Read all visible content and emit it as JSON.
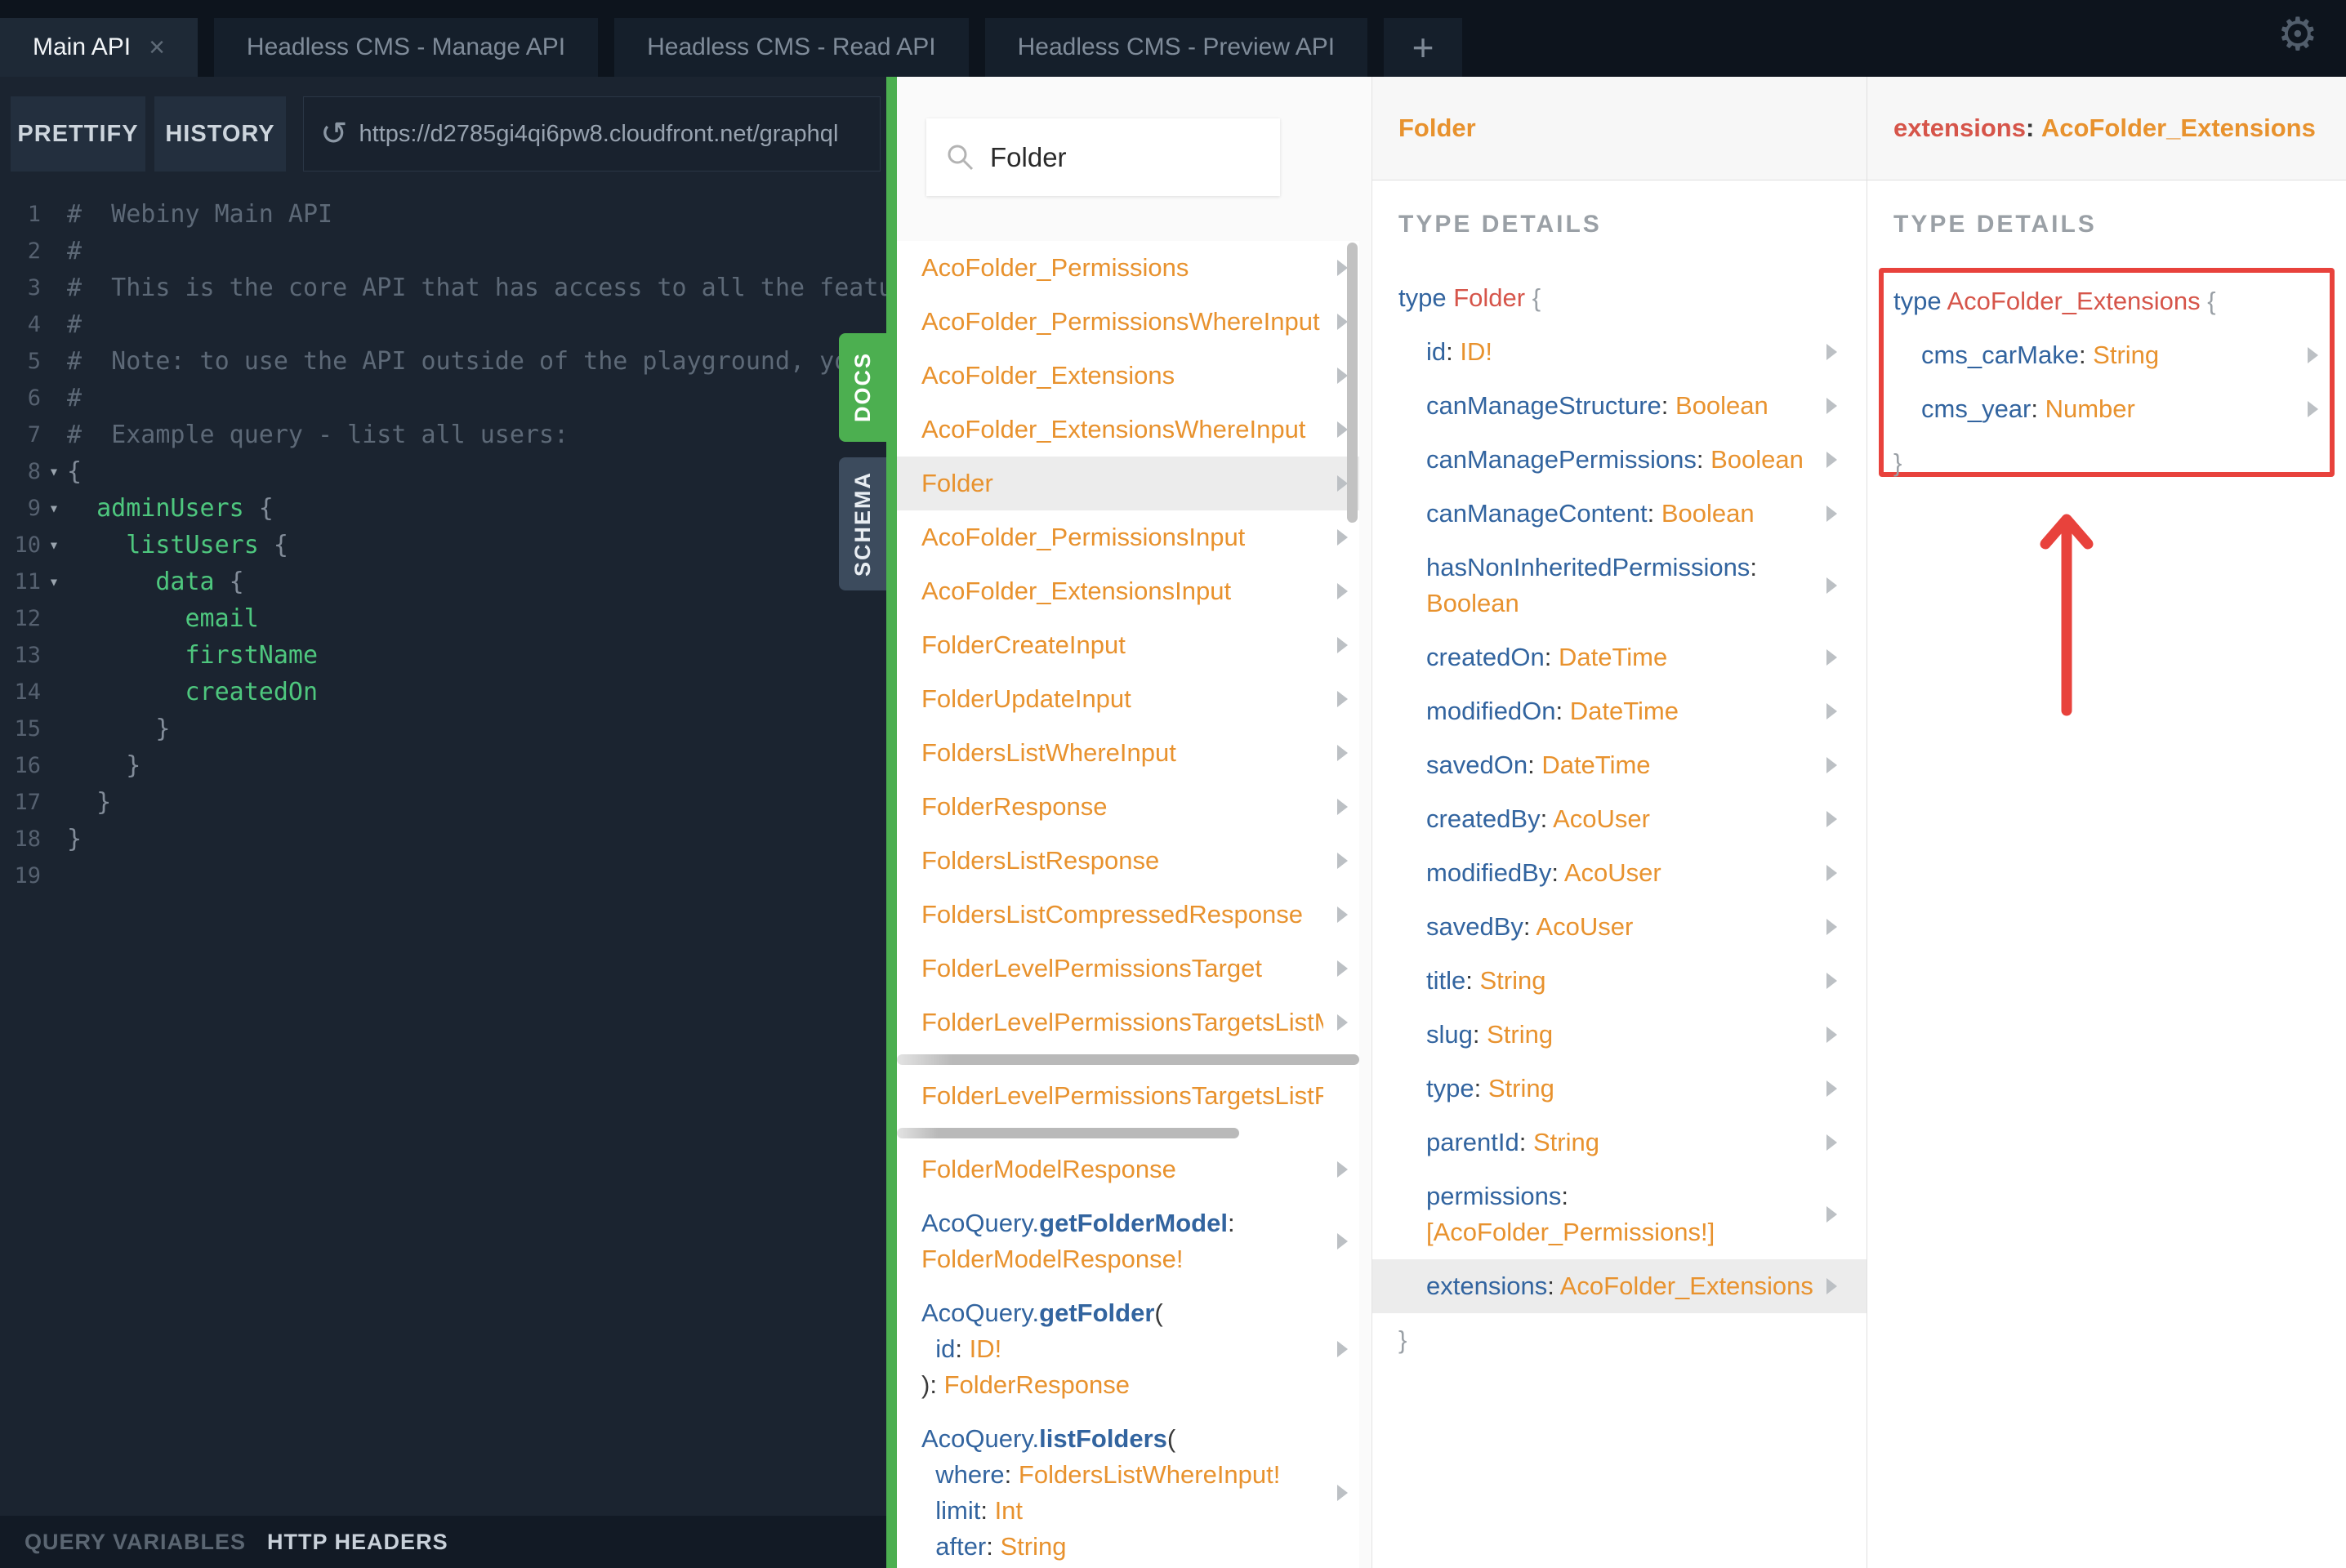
{
  "colors": {
    "accent_green": "#4caf50",
    "type_orange": "#e8922e",
    "field_blue": "#32649f",
    "typename_red": "#d6554a",
    "annotation_red": "#e8423c",
    "editor_green": "#4ec77e"
  },
  "tabs": {
    "items": [
      {
        "label": "Main API",
        "active": true,
        "close": "×"
      },
      {
        "label": "Headless CMS - Manage API",
        "active": false
      },
      {
        "label": "Headless CMS - Read API",
        "active": false
      },
      {
        "label": "Headless CMS - Preview API",
        "active": false
      }
    ],
    "add_label": "+"
  },
  "toolbar": {
    "prettify_label": "PRETTIFY",
    "history_label": "HISTORY",
    "refresh_icon": "↺",
    "url": "https://d2785gi4qi6pw8.cloudfront.net/graphql"
  },
  "gear_icon": "⚙",
  "side_tabs": {
    "docs": "DOCS",
    "schema": "SCHEMA"
  },
  "footer": {
    "query_variables": "QUERY VARIABLES",
    "http_headers": "HTTP HEADERS"
  },
  "editor": {
    "lines": [
      {
        "n": "1",
        "fold": false,
        "segs": [
          {
            "t": "#  Webiny Main API",
            "c": "cm"
          }
        ]
      },
      {
        "n": "2",
        "fold": false,
        "segs": [
          {
            "t": "#",
            "c": "cm"
          }
        ]
      },
      {
        "n": "3",
        "fold": false,
        "segs": [
          {
            "t": "#  This is the core API that has access to all the featu",
            "c": "cm"
          }
        ]
      },
      {
        "n": "4",
        "fold": false,
        "segs": [
          {
            "t": "#",
            "c": "cm"
          }
        ]
      },
      {
        "n": "5",
        "fold": false,
        "segs": [
          {
            "t": "#  Note: to use the API outside of the playground, yo",
            "c": "cm"
          }
        ]
      },
      {
        "n": "6",
        "fold": false,
        "segs": [
          {
            "t": "#",
            "c": "cm"
          }
        ]
      },
      {
        "n": "7",
        "fold": false,
        "segs": [
          {
            "t": "#  Example query - list all users:",
            "c": "cm"
          }
        ]
      },
      {
        "n": "8",
        "fold": true,
        "segs": [
          {
            "t": "{",
            "c": "brc"
          }
        ]
      },
      {
        "n": "9",
        "fold": true,
        "segs": [
          {
            "t": "  adminUsers",
            "c": "gr"
          },
          {
            "t": " {",
            "c": "brc"
          }
        ]
      },
      {
        "n": "10",
        "fold": true,
        "segs": [
          {
            "t": "    listUsers",
            "c": "gr"
          },
          {
            "t": " {",
            "c": "brc"
          }
        ]
      },
      {
        "n": "11",
        "fold": true,
        "segs": [
          {
            "t": "      data",
            "c": "gr"
          },
          {
            "t": " {",
            "c": "brc"
          }
        ]
      },
      {
        "n": "12",
        "fold": false,
        "segs": [
          {
            "t": "        email",
            "c": "gr"
          }
        ]
      },
      {
        "n": "13",
        "fold": false,
        "segs": [
          {
            "t": "        firstName",
            "c": "gr"
          }
        ]
      },
      {
        "n": "14",
        "fold": false,
        "segs": [
          {
            "t": "        createdOn",
            "c": "gr"
          }
        ]
      },
      {
        "n": "15",
        "fold": false,
        "segs": [
          {
            "t": "      }",
            "c": "brc"
          }
        ]
      },
      {
        "n": "16",
        "fold": false,
        "segs": [
          {
            "t": "    }",
            "c": "brc"
          }
        ]
      },
      {
        "n": "17",
        "fold": false,
        "segs": [
          {
            "t": "  }",
            "c": "brc"
          }
        ]
      },
      {
        "n": "18",
        "fold": false,
        "segs": [
          {
            "t": "}",
            "c": "brc"
          }
        ]
      },
      {
        "n": "19",
        "fold": false,
        "segs": [
          {
            "t": "",
            "c": "cm"
          }
        ]
      }
    ]
  },
  "explorer": {
    "search_value": "Folder",
    "rows": [
      {
        "click": true,
        "ch": true,
        "lines": [
          [
            {
              "t": "AcoFolder_Permissions",
              "c": "or"
            }
          ]
        ]
      },
      {
        "click": true,
        "ch": true,
        "lines": [
          [
            {
              "t": "AcoFolder_PermissionsWhereInput",
              "c": "or"
            }
          ]
        ]
      },
      {
        "click": true,
        "ch": true,
        "lines": [
          [
            {
              "t": "AcoFolder_Extensions",
              "c": "or"
            }
          ]
        ]
      },
      {
        "click": true,
        "ch": true,
        "lines": [
          [
            {
              "t": "AcoFolder_ExtensionsWhereInput",
              "c": "or"
            }
          ]
        ]
      },
      {
        "click": true,
        "ch": true,
        "h": true,
        "lines": [
          [
            {
              "t": "Folder",
              "c": "or"
            }
          ]
        ]
      },
      {
        "click": true,
        "ch": true,
        "lines": [
          [
            {
              "t": "AcoFolder_PermissionsInput",
              "c": "or"
            }
          ]
        ]
      },
      {
        "click": true,
        "ch": true,
        "lines": [
          [
            {
              "t": "AcoFolder_ExtensionsInput",
              "c": "or"
            }
          ]
        ]
      },
      {
        "click": true,
        "ch": true,
        "lines": [
          [
            {
              "t": "FolderCreateInput",
              "c": "or"
            }
          ]
        ]
      },
      {
        "click": true,
        "ch": true,
        "lines": [
          [
            {
              "t": "FolderUpdateInput",
              "c": "or"
            }
          ]
        ]
      },
      {
        "click": true,
        "ch": true,
        "lines": [
          [
            {
              "t": "FoldersListWhereInput",
              "c": "or"
            }
          ]
        ]
      },
      {
        "click": true,
        "ch": true,
        "lines": [
          [
            {
              "t": "FolderResponse",
              "c": "or"
            }
          ]
        ]
      },
      {
        "click": true,
        "ch": true,
        "lines": [
          [
            {
              "t": "FoldersListResponse",
              "c": "or"
            }
          ]
        ]
      },
      {
        "click": true,
        "ch": true,
        "lines": [
          [
            {
              "t": "FoldersListCompressedResponse",
              "c": "or"
            }
          ]
        ]
      },
      {
        "click": true,
        "ch": true,
        "lines": [
          [
            {
              "t": "FolderLevelPermissionsTarget",
              "c": "or"
            }
          ]
        ]
      },
      {
        "click": true,
        "ch": true,
        "lines": [
          [
            {
              "t": "FolderLevelPermissionsTargetsListMeta",
              "c": "or"
            }
          ]
        ]
      },
      {
        "type": "hbar",
        "w": "100%"
      },
      {
        "click": true,
        "ch": false,
        "lines": [
          [
            {
              "t": "FolderLevelPermissionsTargetsListRespo",
              "c": "or"
            }
          ]
        ]
      },
      {
        "type": "hbar",
        "w": "74%"
      },
      {
        "click": true,
        "ch": true,
        "lines": [
          [
            {
              "t": "FolderModelResponse",
              "c": "or"
            }
          ]
        ]
      },
      {
        "click": true,
        "ch": true,
        "lines": [
          [
            {
              "t": "AcoQuery.",
              "c": "bl"
            },
            {
              "t": "getFolderModel",
              "c": "bb"
            },
            {
              "t": ":",
              "c": "dk"
            }
          ],
          [
            {
              "t": "FolderModelResponse!",
              "c": "or"
            }
          ]
        ]
      },
      {
        "click": true,
        "ch": true,
        "lines": [
          [
            {
              "t": "AcoQuery.",
              "c": "bl"
            },
            {
              "t": "getFolder",
              "c": "bb"
            },
            {
              "t": "(",
              "c": "dk"
            }
          ],
          [
            {
              "t": "  id",
              "c": "bl"
            },
            {
              "t": ": ",
              "c": "dk"
            },
            {
              "t": "ID!",
              "c": "or"
            }
          ],
          [
            {
              "t": "): ",
              "c": "dk"
            },
            {
              "t": "FolderResponse",
              "c": "or"
            }
          ]
        ]
      },
      {
        "click": true,
        "ch": true,
        "lines": [
          [
            {
              "t": "AcoQuery.",
              "c": "bl"
            },
            {
              "t": "listFolders",
              "c": "bb"
            },
            {
              "t": "(",
              "c": "dk"
            }
          ],
          [
            {
              "t": "  where",
              "c": "bl"
            },
            {
              "t": ": ",
              "c": "dk"
            },
            {
              "t": "FoldersListWhereInput!",
              "c": "or"
            }
          ],
          [
            {
              "t": "  limit",
              "c": "bl"
            },
            {
              "t": ": ",
              "c": "dk"
            },
            {
              "t": "Int",
              "c": "or"
            }
          ],
          [
            {
              "t": "  after",
              "c": "bl"
            },
            {
              "t": ": ",
              "c": "dk"
            },
            {
              "t": "String",
              "c": "or"
            }
          ]
        ]
      }
    ]
  },
  "pane3": {
    "title": "Folder",
    "section_label": "TYPE DETAILS",
    "rows": [
      {
        "lines": [
          [
            {
              "t": "type ",
              "c": "kw"
            },
            {
              "t": "Folder",
              "c": "rd"
            },
            {
              "t": " {",
              "c": "br"
            }
          ]
        ]
      },
      {
        "click": true,
        "ch": true,
        "ind": 1,
        "lines": [
          [
            {
              "t": "id",
              "c": "bl"
            },
            {
              "t": ": ",
              "c": "dk"
            },
            {
              "t": "ID!",
              "c": "or"
            }
          ]
        ]
      },
      {
        "click": true,
        "ch": true,
        "ind": 1,
        "lines": [
          [
            {
              "t": "canManageStructure",
              "c": "bl"
            },
            {
              "t": ": ",
              "c": "dk"
            },
            {
              "t": "Boolean",
              "c": "or"
            }
          ]
        ]
      },
      {
        "click": true,
        "ch": true,
        "ind": 1,
        "lines": [
          [
            {
              "t": "canManagePermissions",
              "c": "bl"
            },
            {
              "t": ": ",
              "c": "dk"
            },
            {
              "t": "Boolean",
              "c": "or"
            }
          ]
        ]
      },
      {
        "click": true,
        "ch": true,
        "ind": 1,
        "lines": [
          [
            {
              "t": "canManageContent",
              "c": "bl"
            },
            {
              "t": ": ",
              "c": "dk"
            },
            {
              "t": "Boolean",
              "c": "or"
            }
          ]
        ]
      },
      {
        "click": true,
        "ch": true,
        "ind": 1,
        "lines": [
          [
            {
              "t": "hasNonInheritedPermissions",
              "c": "bl"
            },
            {
              "t": ":",
              "c": "dk"
            }
          ],
          [
            {
              "t": "Boolean",
              "c": "or"
            }
          ]
        ]
      },
      {
        "click": true,
        "ch": true,
        "ind": 1,
        "lines": [
          [
            {
              "t": "createdOn",
              "c": "bl"
            },
            {
              "t": ": ",
              "c": "dk"
            },
            {
              "t": "DateTime",
              "c": "or"
            }
          ]
        ]
      },
      {
        "click": true,
        "ch": true,
        "ind": 1,
        "lines": [
          [
            {
              "t": "modifiedOn",
              "c": "bl"
            },
            {
              "t": ": ",
              "c": "dk"
            },
            {
              "t": "DateTime",
              "c": "or"
            }
          ]
        ]
      },
      {
        "click": true,
        "ch": true,
        "ind": 1,
        "lines": [
          [
            {
              "t": "savedOn",
              "c": "bl"
            },
            {
              "t": ": ",
              "c": "dk"
            },
            {
              "t": "DateTime",
              "c": "or"
            }
          ]
        ]
      },
      {
        "click": true,
        "ch": true,
        "ind": 1,
        "lines": [
          [
            {
              "t": "createdBy",
              "c": "bl"
            },
            {
              "t": ": ",
              "c": "dk"
            },
            {
              "t": "AcoUser",
              "c": "or"
            }
          ]
        ]
      },
      {
        "click": true,
        "ch": true,
        "ind": 1,
        "lines": [
          [
            {
              "t": "modifiedBy",
              "c": "bl"
            },
            {
              "t": ": ",
              "c": "dk"
            },
            {
              "t": "AcoUser",
              "c": "or"
            }
          ]
        ]
      },
      {
        "click": true,
        "ch": true,
        "ind": 1,
        "lines": [
          [
            {
              "t": "savedBy",
              "c": "bl"
            },
            {
              "t": ": ",
              "c": "dk"
            },
            {
              "t": "AcoUser",
              "c": "or"
            }
          ]
        ]
      },
      {
        "click": true,
        "ch": true,
        "ind": 1,
        "lines": [
          [
            {
              "t": "title",
              "c": "bl"
            },
            {
              "t": ": ",
              "c": "dk"
            },
            {
              "t": "String",
              "c": "or"
            }
          ]
        ]
      },
      {
        "click": true,
        "ch": true,
        "ind": 1,
        "lines": [
          [
            {
              "t": "slug",
              "c": "bl"
            },
            {
              "t": ": ",
              "c": "dk"
            },
            {
              "t": "String",
              "c": "or"
            }
          ]
        ]
      },
      {
        "click": true,
        "ch": true,
        "ind": 1,
        "lines": [
          [
            {
              "t": "type",
              "c": "bl"
            },
            {
              "t": ": ",
              "c": "dk"
            },
            {
              "t": "String",
              "c": "or"
            }
          ]
        ]
      },
      {
        "click": true,
        "ch": true,
        "ind": 1,
        "lines": [
          [
            {
              "t": "parentId",
              "c": "bl"
            },
            {
              "t": ": ",
              "c": "dk"
            },
            {
              "t": "String",
              "c": "or"
            }
          ]
        ]
      },
      {
        "click": true,
        "ch": true,
        "ind": 1,
        "lines": [
          [
            {
              "t": "permissions",
              "c": "bl"
            },
            {
              "t": ":",
              "c": "dk"
            }
          ],
          [
            {
              "t": "[AcoFolder_Permissions!]",
              "c": "or"
            }
          ]
        ]
      },
      {
        "click": true,
        "ch": true,
        "ind": 1,
        "h": true,
        "lines": [
          [
            {
              "t": "extensions",
              "c": "bl"
            },
            {
              "t": ": ",
              "c": "dk"
            },
            {
              "t": "AcoFolder_Extensions",
              "c": "or"
            }
          ]
        ]
      },
      {
        "lines": [
          [
            {
              "t": "}",
              "c": "br"
            }
          ]
        ]
      }
    ]
  },
  "pane4": {
    "header": {
      "field": "extensions",
      "colon": ": ",
      "type": "AcoFolder_Extensions"
    },
    "section_label": "TYPE DETAILS",
    "rows": [
      {
        "lines": [
          [
            {
              "t": "type ",
              "c": "kw"
            },
            {
              "t": "AcoFolder_Extensions",
              "c": "rd"
            },
            {
              "t": " {",
              "c": "br"
            }
          ]
        ]
      },
      {
        "click": true,
        "ch": true,
        "ind": 1,
        "lines": [
          [
            {
              "t": "cms_carMake",
              "c": "bl"
            },
            {
              "t": ": ",
              "c": "dk"
            },
            {
              "t": "String",
              "c": "or"
            }
          ]
        ]
      },
      {
        "click": true,
        "ch": true,
        "ind": 1,
        "lines": [
          [
            {
              "t": "cms_year",
              "c": "bl"
            },
            {
              "t": ": ",
              "c": "dk"
            },
            {
              "t": "Number",
              "c": "or"
            }
          ]
        ]
      },
      {
        "lines": [
          [
            {
              "t": "}",
              "c": "br"
            }
          ]
        ]
      }
    ]
  }
}
